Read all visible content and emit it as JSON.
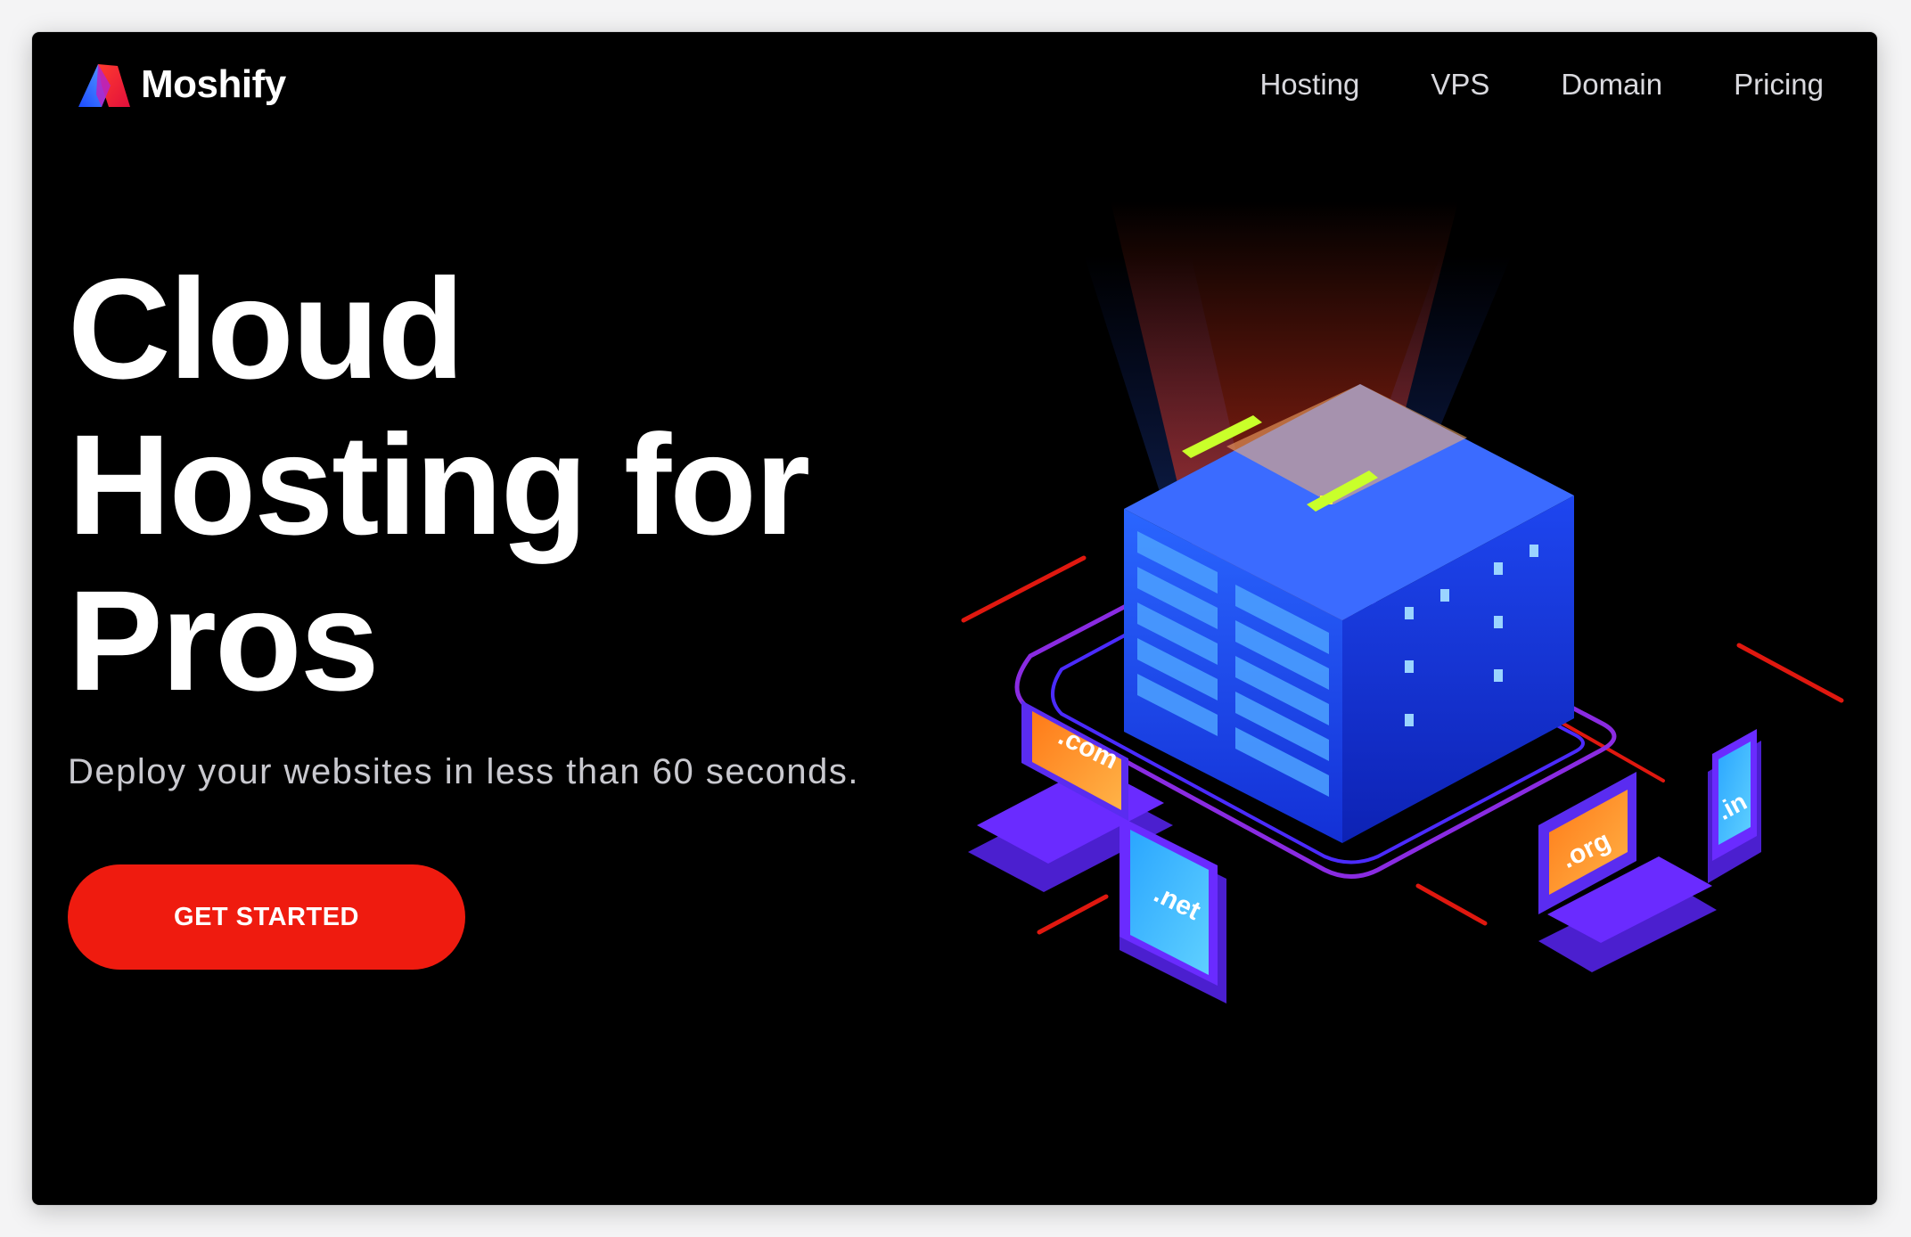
{
  "brand": {
    "name": "Moshify",
    "logo_icon": "moshify-logo-icon",
    "colors": {
      "blue": "#2f6bff",
      "red": "#ff2a3a",
      "pink": "#c32fd0"
    }
  },
  "nav": {
    "items": [
      {
        "label": "Hosting"
      },
      {
        "label": "VPS"
      },
      {
        "label": "Domain"
      },
      {
        "label": "Pricing"
      }
    ]
  },
  "hero": {
    "headline": "Cloud Hosting for Pros",
    "subtitle": "Deploy your websites in less than 60 seconds.",
    "cta_label": "GET STARTED"
  },
  "illustration": {
    "icon": "server-network-illustration",
    "devices": [
      {
        "type": "laptop",
        "tld": ".com"
      },
      {
        "type": "tablet",
        "tld": ".net"
      },
      {
        "type": "laptop",
        "tld": ".org"
      },
      {
        "type": "phone",
        "tld": ".in"
      }
    ]
  },
  "colors": {
    "background": "#000000",
    "accent": "#ef1b0f",
    "text": "#ffffff",
    "muted": "#c9c9cf"
  }
}
